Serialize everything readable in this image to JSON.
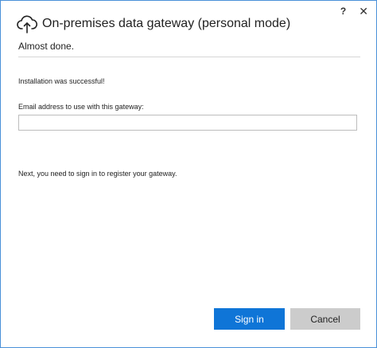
{
  "window": {
    "title": "On-premises data gateway (personal mode)",
    "help_label": "?",
    "close_label": "✕"
  },
  "page": {
    "subtitle": "Almost done.",
    "status": "Installation was successful!",
    "email_label": "Email address to use with this gateway:",
    "email_value": "",
    "email_placeholder": "",
    "next_text": "Next, you need to sign in to register your gateway."
  },
  "buttons": {
    "sign_in": "Sign in",
    "cancel": "Cancel"
  },
  "colors": {
    "accent": "#0f75d7",
    "window_border": "#4a90d9",
    "secondary_button": "#cccccc"
  },
  "icons": {
    "header": "cloud-upload-icon"
  }
}
